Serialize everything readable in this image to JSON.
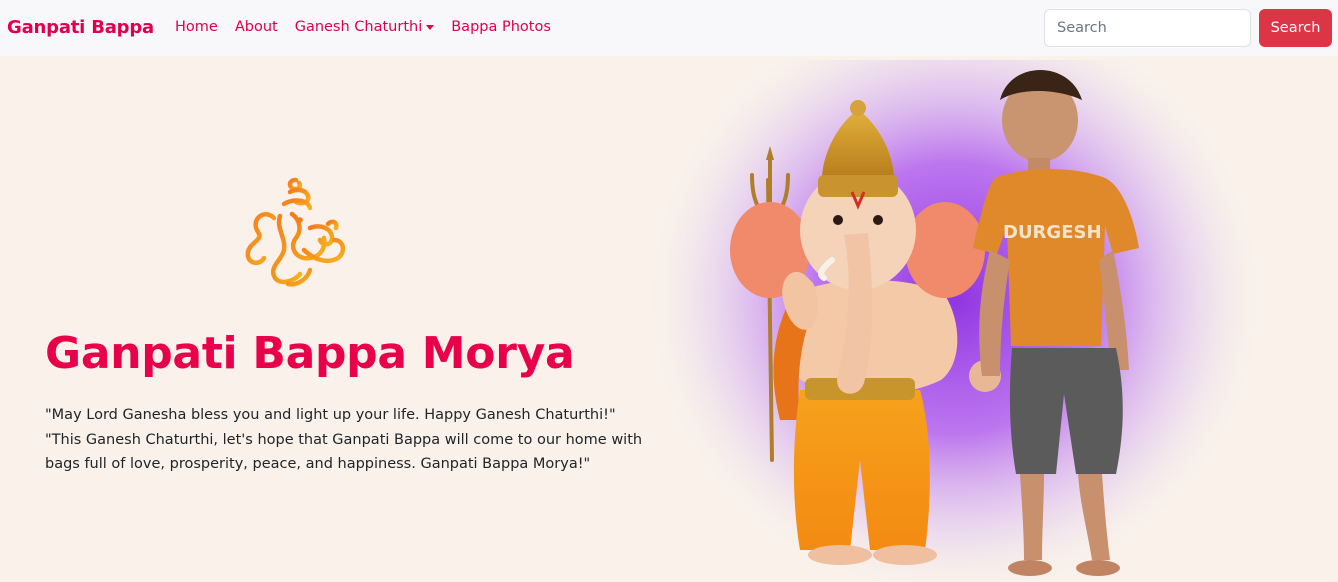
{
  "navbar": {
    "brand": "Ganpati Bappa",
    "links": [
      {
        "label": "Home"
      },
      {
        "label": "About"
      },
      {
        "label": "Ganesh Chaturthi"
      },
      {
        "label": "Bappa Photos"
      }
    ],
    "search": {
      "placeholder": "Search",
      "button_label": "Search"
    }
  },
  "hero": {
    "title": "Ganpati Bappa Morya",
    "paragraphs": [
      "\"May Lord Ganesha bless you and light up your life. Happy Ganesh Chaturthi!\"",
      "\"This Ganesh Chaturthi, let's hope that Ganpati Bappa will come to our home with bags full of love, prosperity, peace, and happiness. Ganpati Bappa Morya!\""
    ],
    "illustration": {
      "tshirt_text": "DURGESH"
    }
  },
  "colors": {
    "brand": "#e0004d",
    "title": "#e8004a",
    "search_button": "#dc3545",
    "page_background": "#f9f1ea",
    "navbar_background": "#f8f8fb",
    "glow": "#9b30ff"
  },
  "icons": [
    "ganesha-logo-icon",
    "dropdown-caret-icon"
  ]
}
